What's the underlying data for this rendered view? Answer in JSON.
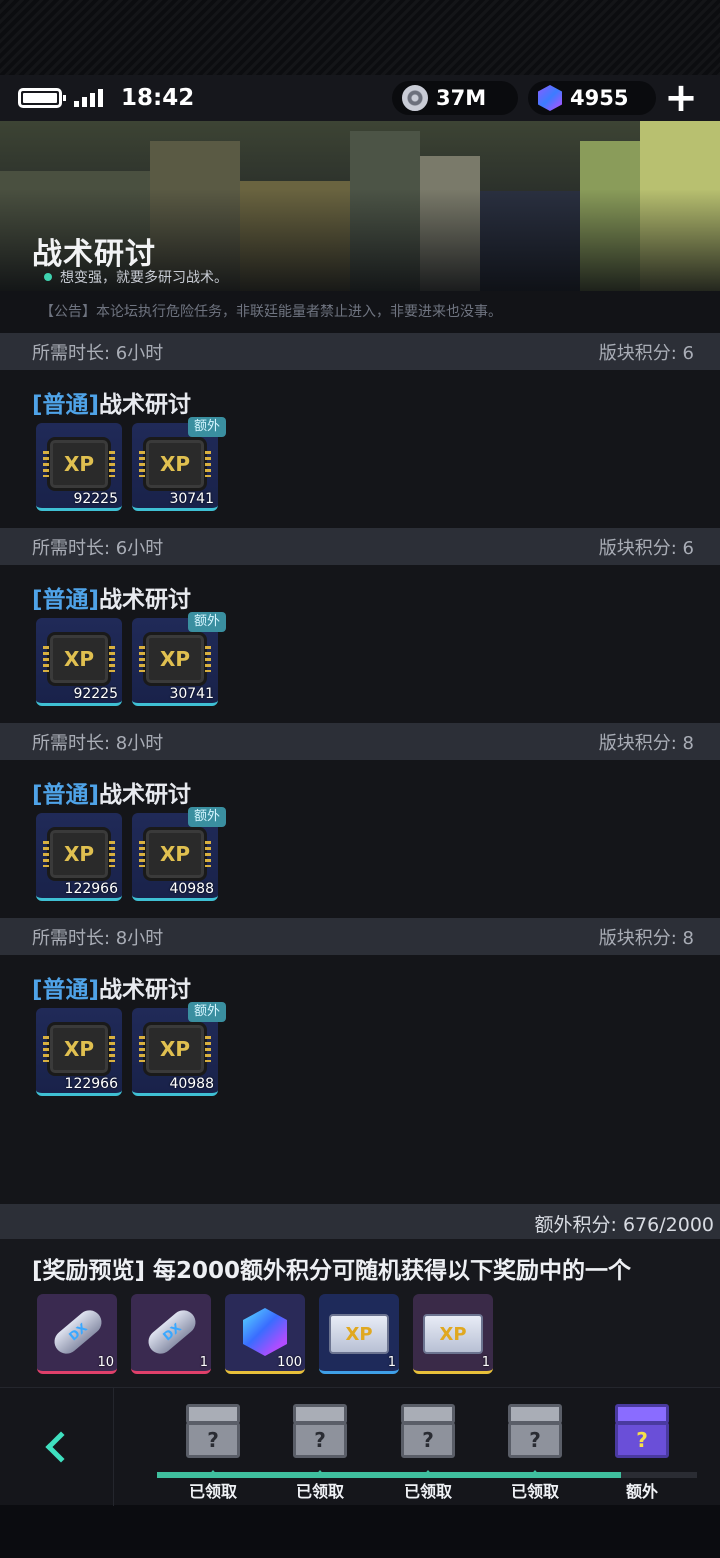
{
  "status_bar": {
    "time": "18:42",
    "credits": "37M",
    "gems": "4955"
  },
  "banner": {
    "title": "战术研讨",
    "subtitle": "想变强，就要多研习战术。",
    "notice": "【公告】本论坛执行危险任务，非联廷能量者禁止进入，非要进来也没事。"
  },
  "tasks": [
    {
      "duration": "所需时长: 6小时",
      "points": "版块积分: 6",
      "tag": "[普通]",
      "name": "战术研讨",
      "rewards": [
        "92225",
        "30741"
      ],
      "extra_label": "额外"
    },
    {
      "duration": "所需时长: 6小时",
      "points": "版块积分: 6",
      "tag": "[普通]",
      "name": "战术研讨",
      "rewards": [
        "92225",
        "30741"
      ],
      "extra_label": "额外"
    },
    {
      "duration": "所需时长: 8小时",
      "points": "版块积分: 8",
      "tag": "[普通]",
      "name": "战术研讨",
      "rewards": [
        "122966",
        "40988"
      ],
      "extra_label": "额外"
    },
    {
      "duration": "所需时长: 8小时",
      "points": "版块积分: 8",
      "tag": "[普通]",
      "name": "战术研讨",
      "rewards": [
        "122966",
        "40988"
      ],
      "extra_label": "额外"
    }
  ],
  "xp_icon_text": "XP",
  "extra_points": {
    "label": "额外积分: 676/2000",
    "current": 676,
    "max": 2000
  },
  "reward_preview": {
    "title": "[奖励预览] 每2000额外积分可随机获得以下奖励中的一个",
    "items": [
      {
        "icon": "dx-capsule-icon",
        "count": "10",
        "border": "#e0406a",
        "bg": "#3a2a50",
        "text": "DX"
      },
      {
        "icon": "dx-capsule-icon",
        "count": "1",
        "border": "#e0406a",
        "bg": "#3a2a50",
        "text": "DX"
      },
      {
        "icon": "cube-icon",
        "count": "100",
        "border": "#e8c03a",
        "bg": "#2a2a58",
        "text": ""
      },
      {
        "icon": "xp-ticket-icon",
        "count": "1",
        "border": "#3fa0e8",
        "bg": "#1e2a5a",
        "text": "XP"
      },
      {
        "icon": "xp-ticket-icon",
        "count": "1",
        "border": "#e8c03a",
        "bg": "#3a2a48",
        "text": "XP"
      }
    ]
  },
  "milestones": [
    {
      "label": "已领取",
      "type": "claimed"
    },
    {
      "label": "已领取",
      "type": "claimed"
    },
    {
      "label": "已领取",
      "type": "claimed"
    },
    {
      "label": "已领取",
      "type": "claimed"
    },
    {
      "label": "额外",
      "type": "extra"
    }
  ],
  "milestone_progress": 0.86,
  "colors": {
    "accent": "#3fe0c0",
    "tag_blue": "#4fa3e8",
    "header_bg": "#2c2f37"
  }
}
